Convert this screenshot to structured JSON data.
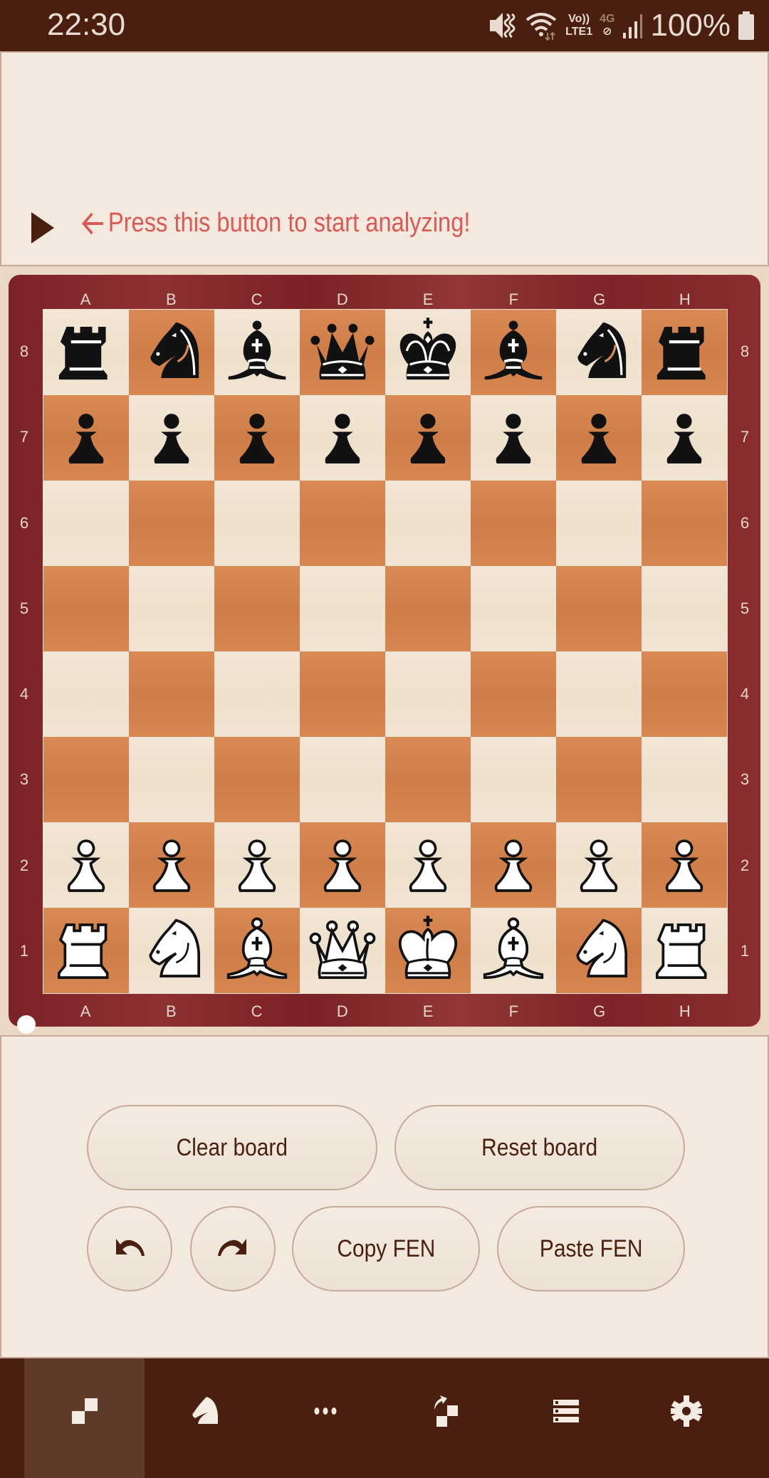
{
  "status_bar": {
    "time": "22:30",
    "icons": [
      "vibrate-mute-icon",
      "wifi-icon",
      "volte-lte-icon",
      "4g-no-data-icon",
      "signal-icon",
      "battery-icon"
    ],
    "volte_top": "Vo))",
    "volte_bottom": "LTE1",
    "net_label": "4G",
    "battery": "100%"
  },
  "analysis": {
    "hint_text": "Press this button to start analyzing!",
    "hint_color": "#d95a55"
  },
  "board": {
    "files": [
      "A",
      "B",
      "C",
      "D",
      "E",
      "F",
      "G",
      "H"
    ],
    "ranks": [
      "8",
      "7",
      "6",
      "5",
      "4",
      "3",
      "2",
      "1"
    ],
    "position": [
      [
        "bR",
        "bN",
        "bB",
        "bQ",
        "bK",
        "bB",
        "bN",
        "bR"
      ],
      [
        "bP",
        "bP",
        "bP",
        "bP",
        "bP",
        "bP",
        "bP",
        "bP"
      ],
      [
        "",
        "",
        "",
        "",
        "",
        "",
        "",
        ""
      ],
      [
        "",
        "",
        "",
        "",
        "",
        "",
        "",
        ""
      ],
      [
        "",
        "",
        "",
        "",
        "",
        "",
        "",
        ""
      ],
      [
        "",
        "",
        "",
        "",
        "",
        "",
        "",
        ""
      ],
      [
        "wP",
        "wP",
        "wP",
        "wP",
        "wP",
        "wP",
        "wP",
        "wP"
      ],
      [
        "wR",
        "wN",
        "wB",
        "wQ",
        "wK",
        "wB",
        "wN",
        "wR"
      ]
    ],
    "side_to_move": "white",
    "colors": {
      "light": "#f0e3d1",
      "dark": "#d4844d",
      "frame": "#842a2d"
    }
  },
  "controls": {
    "clear_board": "Clear board",
    "reset_board": "Reset board",
    "undo_icon": "undo-icon",
    "redo_icon": "redo-icon",
    "copy_fen": "Copy FEN",
    "paste_fen": "Paste FEN"
  },
  "bottom_nav": {
    "items": [
      {
        "name": "board-editor",
        "icon": "board-squares-icon",
        "active": true
      },
      {
        "name": "play",
        "icon": "knight-icon",
        "active": false
      },
      {
        "name": "more",
        "icon": "dots-icon",
        "active": false
      },
      {
        "name": "flip-board",
        "icon": "flip-board-icon",
        "active": false
      },
      {
        "name": "engines",
        "icon": "list-icon",
        "active": false
      },
      {
        "name": "settings",
        "icon": "gear-icon",
        "active": false
      }
    ]
  }
}
